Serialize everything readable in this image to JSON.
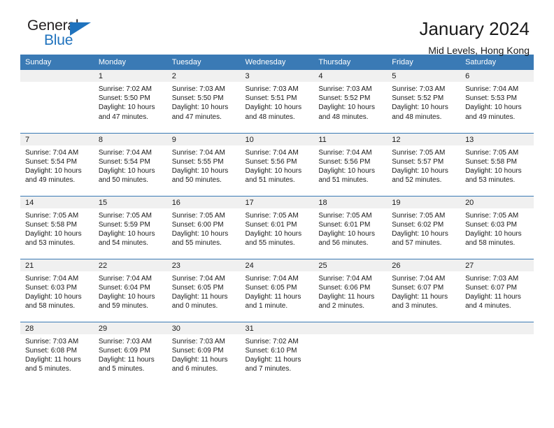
{
  "logo": {
    "text_top": "General",
    "text_bottom": "Blue",
    "triangle_color": "#1f72bd",
    "top_color": "#231f20"
  },
  "header": {
    "title": "January 2024",
    "subtitle": "Mid Levels, Hong Kong"
  },
  "colors": {
    "header_row": "#3a7ab5",
    "day_number_band": "#f0f0f0",
    "grid_line": "#3a7ab5",
    "text": "#1a1a1a"
  },
  "weekday_headers": [
    "Sunday",
    "Monday",
    "Tuesday",
    "Wednesday",
    "Thursday",
    "Friday",
    "Saturday"
  ],
  "weeks": [
    [
      {
        "day": "",
        "sunrise": "",
        "sunset": "",
        "daylight_1": "",
        "daylight_2": ""
      },
      {
        "day": "1",
        "sunrise": "Sunrise: 7:02 AM",
        "sunset": "Sunset: 5:50 PM",
        "daylight_1": "Daylight: 10 hours",
        "daylight_2": "and 47 minutes."
      },
      {
        "day": "2",
        "sunrise": "Sunrise: 7:03 AM",
        "sunset": "Sunset: 5:50 PM",
        "daylight_1": "Daylight: 10 hours",
        "daylight_2": "and 47 minutes."
      },
      {
        "day": "3",
        "sunrise": "Sunrise: 7:03 AM",
        "sunset": "Sunset: 5:51 PM",
        "daylight_1": "Daylight: 10 hours",
        "daylight_2": "and 48 minutes."
      },
      {
        "day": "4",
        "sunrise": "Sunrise: 7:03 AM",
        "sunset": "Sunset: 5:52 PM",
        "daylight_1": "Daylight: 10 hours",
        "daylight_2": "and 48 minutes."
      },
      {
        "day": "5",
        "sunrise": "Sunrise: 7:03 AM",
        "sunset": "Sunset: 5:52 PM",
        "daylight_1": "Daylight: 10 hours",
        "daylight_2": "and 48 minutes."
      },
      {
        "day": "6",
        "sunrise": "Sunrise: 7:04 AM",
        "sunset": "Sunset: 5:53 PM",
        "daylight_1": "Daylight: 10 hours",
        "daylight_2": "and 49 minutes."
      }
    ],
    [
      {
        "day": "7",
        "sunrise": "Sunrise: 7:04 AM",
        "sunset": "Sunset: 5:54 PM",
        "daylight_1": "Daylight: 10 hours",
        "daylight_2": "and 49 minutes."
      },
      {
        "day": "8",
        "sunrise": "Sunrise: 7:04 AM",
        "sunset": "Sunset: 5:54 PM",
        "daylight_1": "Daylight: 10 hours",
        "daylight_2": "and 50 minutes."
      },
      {
        "day": "9",
        "sunrise": "Sunrise: 7:04 AM",
        "sunset": "Sunset: 5:55 PM",
        "daylight_1": "Daylight: 10 hours",
        "daylight_2": "and 50 minutes."
      },
      {
        "day": "10",
        "sunrise": "Sunrise: 7:04 AM",
        "sunset": "Sunset: 5:56 PM",
        "daylight_1": "Daylight: 10 hours",
        "daylight_2": "and 51 minutes."
      },
      {
        "day": "11",
        "sunrise": "Sunrise: 7:04 AM",
        "sunset": "Sunset: 5:56 PM",
        "daylight_1": "Daylight: 10 hours",
        "daylight_2": "and 51 minutes."
      },
      {
        "day": "12",
        "sunrise": "Sunrise: 7:05 AM",
        "sunset": "Sunset: 5:57 PM",
        "daylight_1": "Daylight: 10 hours",
        "daylight_2": "and 52 minutes."
      },
      {
        "day": "13",
        "sunrise": "Sunrise: 7:05 AM",
        "sunset": "Sunset: 5:58 PM",
        "daylight_1": "Daylight: 10 hours",
        "daylight_2": "and 53 minutes."
      }
    ],
    [
      {
        "day": "14",
        "sunrise": "Sunrise: 7:05 AM",
        "sunset": "Sunset: 5:58 PM",
        "daylight_1": "Daylight: 10 hours",
        "daylight_2": "and 53 minutes."
      },
      {
        "day": "15",
        "sunrise": "Sunrise: 7:05 AM",
        "sunset": "Sunset: 5:59 PM",
        "daylight_1": "Daylight: 10 hours",
        "daylight_2": "and 54 minutes."
      },
      {
        "day": "16",
        "sunrise": "Sunrise: 7:05 AM",
        "sunset": "Sunset: 6:00 PM",
        "daylight_1": "Daylight: 10 hours",
        "daylight_2": "and 55 minutes."
      },
      {
        "day": "17",
        "sunrise": "Sunrise: 7:05 AM",
        "sunset": "Sunset: 6:01 PM",
        "daylight_1": "Daylight: 10 hours",
        "daylight_2": "and 55 minutes."
      },
      {
        "day": "18",
        "sunrise": "Sunrise: 7:05 AM",
        "sunset": "Sunset: 6:01 PM",
        "daylight_1": "Daylight: 10 hours",
        "daylight_2": "and 56 minutes."
      },
      {
        "day": "19",
        "sunrise": "Sunrise: 7:05 AM",
        "sunset": "Sunset: 6:02 PM",
        "daylight_1": "Daylight: 10 hours",
        "daylight_2": "and 57 minutes."
      },
      {
        "day": "20",
        "sunrise": "Sunrise: 7:05 AM",
        "sunset": "Sunset: 6:03 PM",
        "daylight_1": "Daylight: 10 hours",
        "daylight_2": "and 58 minutes."
      }
    ],
    [
      {
        "day": "21",
        "sunrise": "Sunrise: 7:04 AM",
        "sunset": "Sunset: 6:03 PM",
        "daylight_1": "Daylight: 10 hours",
        "daylight_2": "and 58 minutes."
      },
      {
        "day": "22",
        "sunrise": "Sunrise: 7:04 AM",
        "sunset": "Sunset: 6:04 PM",
        "daylight_1": "Daylight: 10 hours",
        "daylight_2": "and 59 minutes."
      },
      {
        "day": "23",
        "sunrise": "Sunrise: 7:04 AM",
        "sunset": "Sunset: 6:05 PM",
        "daylight_1": "Daylight: 11 hours",
        "daylight_2": "and 0 minutes."
      },
      {
        "day": "24",
        "sunrise": "Sunrise: 7:04 AM",
        "sunset": "Sunset: 6:05 PM",
        "daylight_1": "Daylight: 11 hours",
        "daylight_2": "and 1 minute."
      },
      {
        "day": "25",
        "sunrise": "Sunrise: 7:04 AM",
        "sunset": "Sunset: 6:06 PM",
        "daylight_1": "Daylight: 11 hours",
        "daylight_2": "and 2 minutes."
      },
      {
        "day": "26",
        "sunrise": "Sunrise: 7:04 AM",
        "sunset": "Sunset: 6:07 PM",
        "daylight_1": "Daylight: 11 hours",
        "daylight_2": "and 3 minutes."
      },
      {
        "day": "27",
        "sunrise": "Sunrise: 7:03 AM",
        "sunset": "Sunset: 6:07 PM",
        "daylight_1": "Daylight: 11 hours",
        "daylight_2": "and 4 minutes."
      }
    ],
    [
      {
        "day": "28",
        "sunrise": "Sunrise: 7:03 AM",
        "sunset": "Sunset: 6:08 PM",
        "daylight_1": "Daylight: 11 hours",
        "daylight_2": "and 5 minutes."
      },
      {
        "day": "29",
        "sunrise": "Sunrise: 7:03 AM",
        "sunset": "Sunset: 6:09 PM",
        "daylight_1": "Daylight: 11 hours",
        "daylight_2": "and 5 minutes."
      },
      {
        "day": "30",
        "sunrise": "Sunrise: 7:03 AM",
        "sunset": "Sunset: 6:09 PM",
        "daylight_1": "Daylight: 11 hours",
        "daylight_2": "and 6 minutes."
      },
      {
        "day": "31",
        "sunrise": "Sunrise: 7:02 AM",
        "sunset": "Sunset: 6:10 PM",
        "daylight_1": "Daylight: 11 hours",
        "daylight_2": "and 7 minutes."
      },
      {
        "day": "",
        "sunrise": "",
        "sunset": "",
        "daylight_1": "",
        "daylight_2": ""
      },
      {
        "day": "",
        "sunrise": "",
        "sunset": "",
        "daylight_1": "",
        "daylight_2": ""
      },
      {
        "day": "",
        "sunrise": "",
        "sunset": "",
        "daylight_1": "",
        "daylight_2": ""
      }
    ]
  ]
}
